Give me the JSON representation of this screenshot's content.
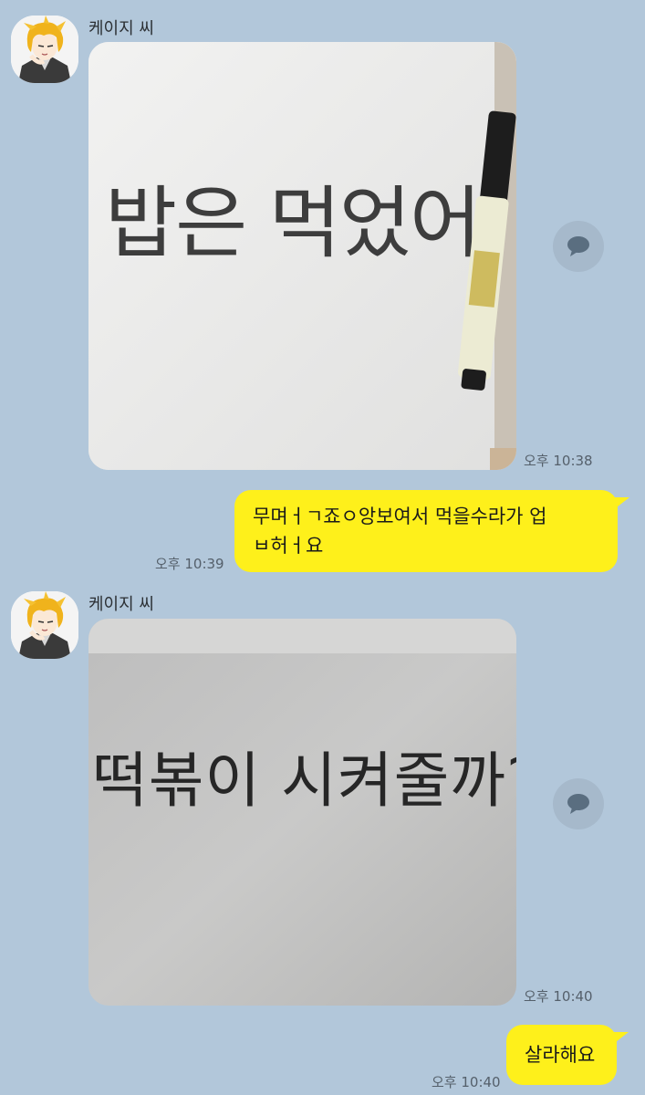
{
  "messages": [
    {
      "sender": "케이지 씨",
      "photo_text": "밥은 먹었어",
      "time": "오후 10:38"
    },
    {
      "text_line1": "무며ㅓㄱ죠ㅇ앙보여서 먹을수라가 업",
      "text_line2": "ㅂ허ㅓ요",
      "time": "오후 10:39"
    },
    {
      "sender": "케이지 씨",
      "photo_text": "떡볶이 시켜줄까?",
      "time": "오후 10:40"
    },
    {
      "text": "살라해요",
      "time": "오후 10:40"
    }
  ],
  "colors": {
    "background": "#b2c7da",
    "my_bubble": "#fef01b"
  },
  "icons": {
    "avatar": "anime-character-avatar",
    "share": "speech-bubble-icon",
    "marker": "marker-pen"
  }
}
